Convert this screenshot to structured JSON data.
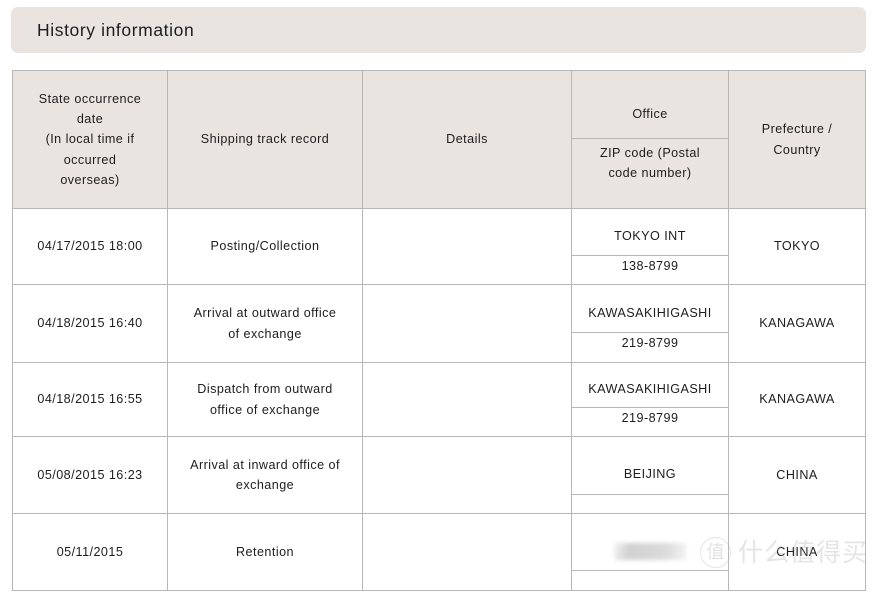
{
  "page": {
    "title": "History information",
    "watermark": {
      "logo_glyph": "值",
      "text": "什么值得买"
    },
    "colors": {
      "header_background": "#e9e4df",
      "border": "#b9b6b3",
      "text": "#1d1d1d",
      "body_background": "#ffffff"
    }
  },
  "table": {
    "headers": {
      "date": "State occurrence date\n(In local time if occurred overseas)",
      "date_line1": "State occurrence",
      "date_line2": "date",
      "date_line3": "(In local time if",
      "date_line4": "occurred",
      "date_line5": "overseas)",
      "track": "Shipping track record",
      "details": "Details",
      "office": "Office",
      "zip": "ZIP code (Postal code number)",
      "zip_line1": "ZIP code (Postal",
      "zip_line2": "code number)",
      "prefecture": "Prefecture / Country",
      "prefecture_line1": "Prefecture /",
      "prefecture_line2": "Country"
    },
    "rows": [
      {
        "date": "04/17/2015 18:00",
        "track": "Posting/Collection",
        "track_line1": "Posting/Collection",
        "track_line2": "",
        "details": "",
        "office_name": "TOKYO INT",
        "zip": "138-8799",
        "prefecture": "TOKYO",
        "redacted": false
      },
      {
        "date": "04/18/2015 16:40",
        "track": "Arrival at outward office of exchange",
        "track_line1": "Arrival at outward office",
        "track_line2": "of exchange",
        "details": "",
        "office_name": "KAWASAKIHIGASHI",
        "zip": "219-8799",
        "prefecture": "KANAGAWA",
        "redacted": false
      },
      {
        "date": "04/18/2015 16:55",
        "track": "Dispatch from outward office of exchange",
        "track_line1": "Dispatch from outward",
        "track_line2": "office of exchange",
        "details": "",
        "office_name": "KAWASAKIHIGASHI",
        "zip": "219-8799",
        "prefecture": "KANAGAWA",
        "redacted": false
      },
      {
        "date": "05/08/2015 16:23",
        "track": "Arrival at inward office of exchange",
        "track_line1": "Arrival at inward office of",
        "track_line2": "exchange",
        "details": "",
        "office_name": "BEIJING",
        "zip": "",
        "prefecture": "CHINA",
        "redacted": false
      },
      {
        "date": "05/11/2015",
        "track": "Retention",
        "track_line1": "Retention",
        "track_line2": "",
        "details": "",
        "office_name": "",
        "zip": "",
        "prefecture": "CHINA",
        "redacted": true
      }
    ]
  }
}
